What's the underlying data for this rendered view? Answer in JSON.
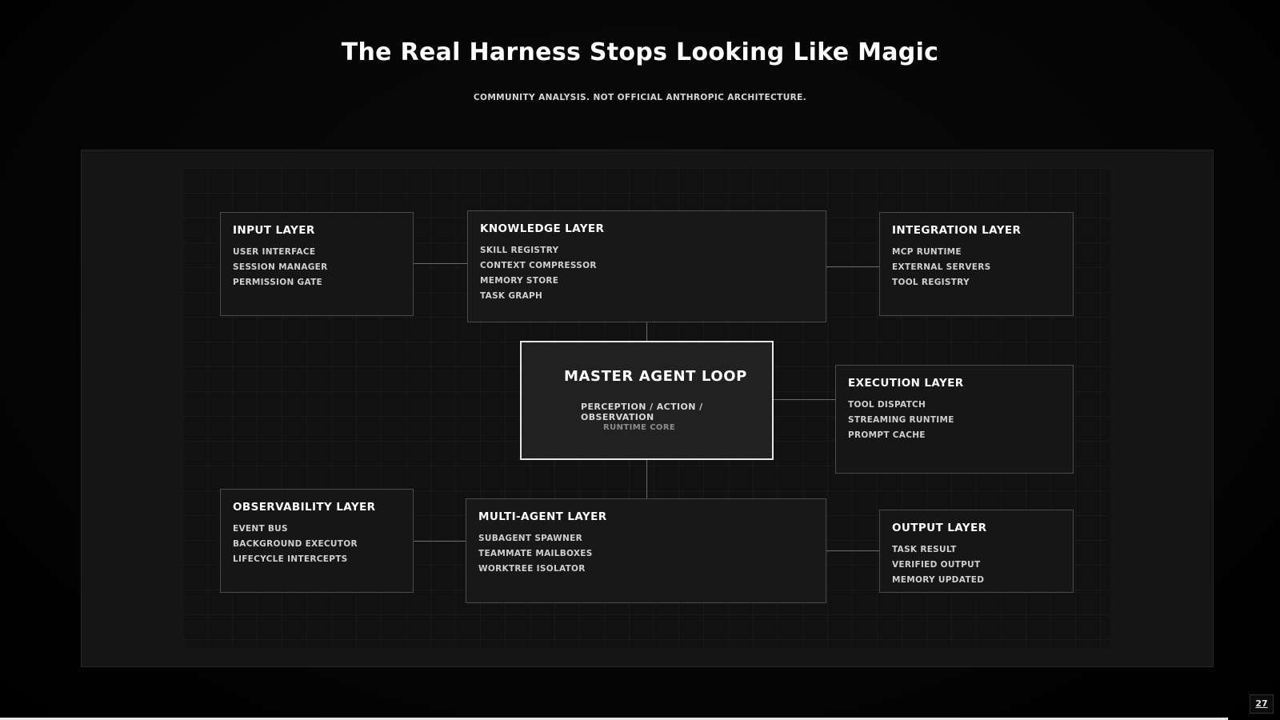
{
  "title": "The Real Harness Stops Looking Like Magic",
  "subtitle": "COMMUNITY ANALYSIS. NOT OFFICIAL ANTHROPIC ARCHITECTURE.",
  "master": {
    "title": "MASTER AGENT LOOP",
    "subtitle": "PERCEPTION / ACTION / OBSERVATION",
    "core": "RUNTIME CORE"
  },
  "layers": {
    "input": {
      "title": "INPUT LAYER",
      "items": [
        "USER INTERFACE",
        "SESSION MANAGER",
        "PERMISSION GATE"
      ]
    },
    "knowledge": {
      "title": "KNOWLEDGE LAYER",
      "items": [
        "SKILL REGISTRY",
        "CONTEXT COMPRESSOR",
        "MEMORY STORE",
        "TASK GRAPH"
      ]
    },
    "integration": {
      "title": "INTEGRATION LAYER",
      "items": [
        "MCP RUNTIME",
        "EXTERNAL SERVERS",
        "TOOL REGISTRY"
      ]
    },
    "execution": {
      "title": "EXECUTION LAYER",
      "items": [
        "TOOL DISPATCH",
        "STREAMING RUNTIME",
        "PROMPT CACHE"
      ]
    },
    "observability": {
      "title": "OBSERVABILITY LAYER",
      "items": [
        "EVENT BUS",
        "BACKGROUND EXECUTOR",
        "LIFECYCLE INTERCEPTS"
      ]
    },
    "multiagent": {
      "title": "MULTI-AGENT LAYER",
      "items": [
        "SUBAGENT SPAWNER",
        "TEAMMATE MAILBOXES",
        "WORKTREE ISOLATOR"
      ]
    },
    "output": {
      "title": "OUTPUT LAYER",
      "items": [
        "TASK RESULT",
        "VERIFIED OUTPUT",
        "MEMORY UPDATED"
      ]
    }
  },
  "page_number": "27"
}
